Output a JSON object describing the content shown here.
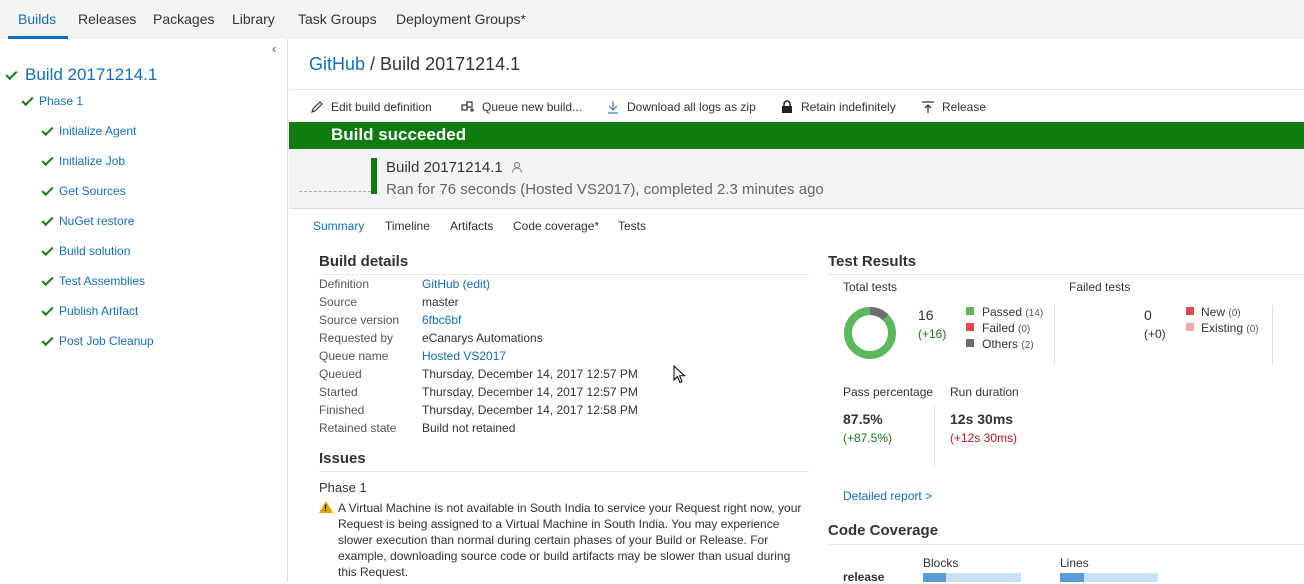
{
  "topnav": {
    "tabs": [
      "Builds",
      "Releases",
      "Packages",
      "Library",
      "Task Groups",
      "Deployment Groups*"
    ],
    "active": "Builds"
  },
  "sidebar": {
    "collapse_glyph": "‹",
    "build": "Build 20171214.1",
    "phase": "Phase 1",
    "steps": [
      "Initialize Agent",
      "Initialize Job",
      "Get Sources",
      "NuGet restore",
      "Build solution",
      "Test Assemblies",
      "Publish Artifact",
      "Post Job Cleanup"
    ]
  },
  "breadcrumb": {
    "project": "GitHub",
    "separator": " / ",
    "build": "Build 20171214.1"
  },
  "toolbar": {
    "edit": "Edit build definition",
    "queue": "Queue new build...",
    "download": "Download all logs as zip",
    "retain": "Retain indefinitely",
    "release": "Release"
  },
  "banner": {
    "text": "Build succeeded"
  },
  "build_header": {
    "title": "Build 20171214.1",
    "subtitle": "Ran for 76 seconds (Hosted VS2017), completed 2.3 minutes ago"
  },
  "tabs": [
    "Summary",
    "Timeline",
    "Artifacts",
    "Code coverage*",
    "Tests"
  ],
  "build_details": {
    "title": "Build details",
    "rows": [
      {
        "key": "Definition",
        "value": "GitHub (edit)"
      },
      {
        "key": "Source",
        "value": "master"
      },
      {
        "key": "Source version",
        "value": "6fbc6bf"
      },
      {
        "key": "Requested by",
        "value": "eCanarys Automations"
      },
      {
        "key": "Queue name",
        "value": "Hosted VS2017"
      },
      {
        "key": "Queued",
        "value": "Thursday, December 14, 2017 12:57 PM"
      },
      {
        "key": "Started",
        "value": "Thursday, December 14, 2017 12:57 PM"
      },
      {
        "key": "Finished",
        "value": "Thursday, December 14, 2017 12:58 PM"
      },
      {
        "key": "Retained state",
        "value": "Build not retained"
      }
    ]
  },
  "issues": {
    "title": "Issues",
    "phase": "Phase 1",
    "text": "A Virtual Machine is not available in South India to service your Request right now, your Request is being assigned to a Virtual Machine in South India. You may experience slower execution than normal during certain phases of your Build or Release. For example, downloading source code or build artifacts may be slower than usual during this Request."
  },
  "test_results": {
    "title": "Test Results",
    "total_label": "Total tests",
    "total": "16",
    "total_delta": "(+16)",
    "passed_label": "Passed",
    "passed_count": "(14)",
    "passed": 14,
    "failed_label": "Failed",
    "failed_count": "(0)",
    "failed": 0,
    "others_label": "Others",
    "others_count": "(2)",
    "others": 2,
    "failed_tests_label": "Failed tests",
    "failed_total": "0",
    "failed_delta": "(+0)",
    "new_label": "New",
    "new_count": "(0)",
    "existing_label": "Existing",
    "existing_count": "(0)",
    "pass_pct_label": "Pass percentage",
    "pass_pct": "87.5%",
    "pass_pct_delta": "(+87.5%)",
    "duration_label": "Run duration",
    "duration": "12s 30ms",
    "duration_delta": "(+12s 30ms)",
    "detailed_report": "Detailed report >"
  },
  "code_coverage": {
    "title": "Code Coverage",
    "module": "release",
    "blocks_label": "Blocks",
    "lines_label": "Lines",
    "blocks_fraction": 0.23,
    "lines_fraction": 0.24
  },
  "colors": {
    "accent": "#106ebe",
    "success": "#107c10",
    "passed": "#5cb85c",
    "failed": "#e5484d",
    "others": "#6e6e6e",
    "existing": "#f0a8b0"
  }
}
